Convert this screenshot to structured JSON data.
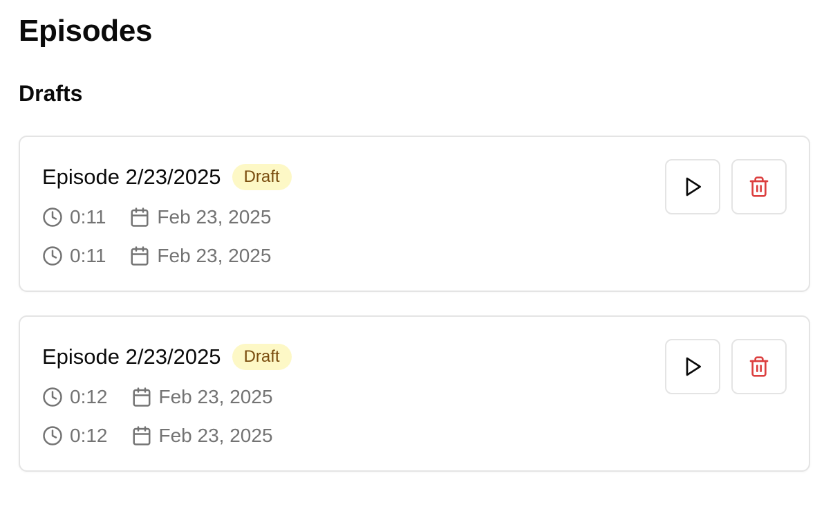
{
  "page": {
    "title": "Episodes",
    "section_title": "Drafts"
  },
  "colors": {
    "badge_bg": "#fdf8c6",
    "badge_text": "#7a4d0f",
    "delete_red": "#dc3f3f",
    "meta_gray": "#737373",
    "border": "#e4e4e4"
  },
  "episodes": [
    {
      "title": "Episode 2/23/2025",
      "status": "Draft",
      "meta": [
        {
          "duration": "0:11",
          "date": "Feb 23, 2025"
        },
        {
          "duration": "0:11",
          "date": "Feb 23, 2025"
        }
      ],
      "actions": {
        "play_icon": "play-icon",
        "delete_icon": "trash-icon"
      }
    },
    {
      "title": "Episode 2/23/2025",
      "status": "Draft",
      "meta": [
        {
          "duration": "0:12",
          "date": "Feb 23, 2025"
        },
        {
          "duration": "0:12",
          "date": "Feb 23, 2025"
        }
      ],
      "actions": {
        "play_icon": "play-icon",
        "delete_icon": "trash-icon"
      }
    }
  ]
}
